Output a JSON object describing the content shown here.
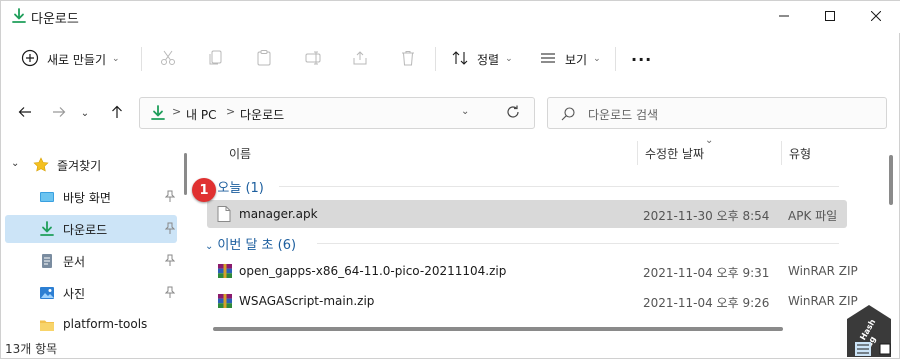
{
  "window": {
    "title": "다운로드",
    "controls": {
      "minimize_icon": "minimize-icon",
      "maximize_icon": "maximize-icon",
      "close_icon": "close-icon"
    }
  },
  "toolbar": {
    "new_label": "새로 만들기",
    "sort_label": "정렬",
    "view_label": "보기",
    "more_glyph": "···"
  },
  "address": {
    "breadcrumbs": [
      "내 PC",
      "다운로드"
    ],
    "separator": ">"
  },
  "search": {
    "placeholder": "다운로드 검색"
  },
  "sidebar": {
    "items": [
      {
        "label": "즐겨찾기",
        "icon": "star-icon",
        "pinned": false,
        "expanded": true
      },
      {
        "label": "바탕 화면",
        "icon": "desktop-icon",
        "pinned": true
      },
      {
        "label": "다운로드",
        "icon": "download-icon",
        "pinned": true,
        "active": true
      },
      {
        "label": "문서",
        "icon": "document-icon",
        "pinned": true
      },
      {
        "label": "사진",
        "icon": "picture-icon",
        "pinned": true
      },
      {
        "label": "platform-tools",
        "icon": "folder-icon",
        "pinned": false
      }
    ]
  },
  "columns": {
    "name": "이름",
    "date": "수정한 날짜",
    "type": "유형"
  },
  "groups": [
    {
      "label": "오늘 (1)",
      "files": [
        {
          "name": "manager.apk",
          "date": "2021-11-30 오후 8:54",
          "type": "APK 파일",
          "icon": "file-icon",
          "selected": true
        }
      ]
    },
    {
      "label": "이번 달 초 (6)",
      "files": [
        {
          "name": "open_gapps-x86_64-11.0-pico-20211104.zip",
          "date": "2021-11-04 오후 9:31",
          "type": "WinRAR ZIP archive",
          "icon": "winrar-icon"
        },
        {
          "name": "WSAGAScript-main.zip",
          "date": "2021-11-04 오후 9:26",
          "type": "WinRAR ZIP archive",
          "icon": "winrar-icon"
        }
      ]
    }
  ],
  "annotation": {
    "badge": "1",
    "color": "#e03131"
  },
  "status": {
    "item_count": "13개 항목"
  },
  "colors": {
    "accent": "#1c5e9e",
    "selection": "#cce4f7",
    "download_green": "#1e9e5a"
  }
}
